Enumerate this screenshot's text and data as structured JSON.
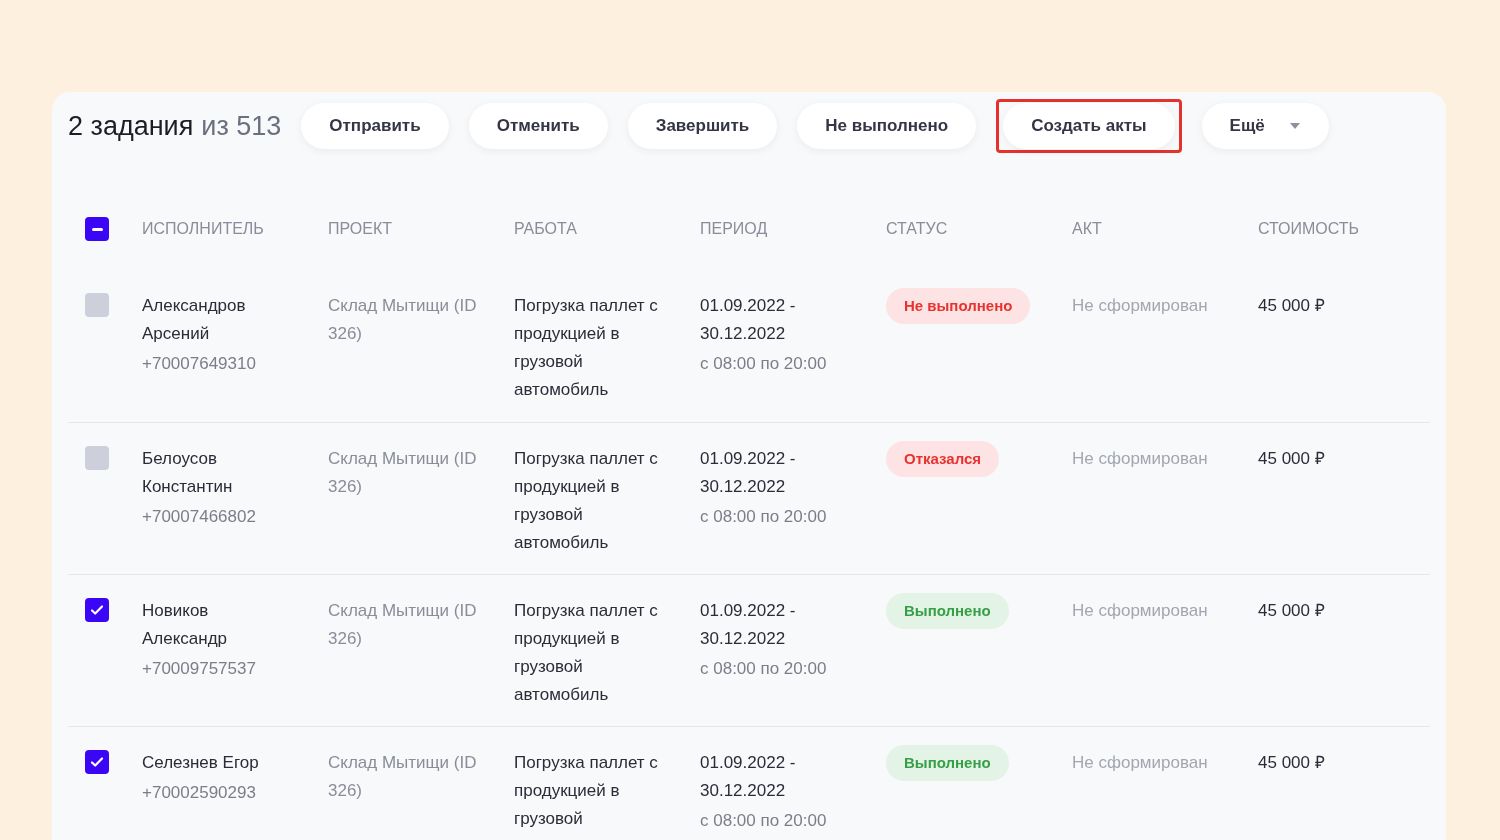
{
  "header": {
    "count": "2 задания",
    "total": "из 513"
  },
  "actions": [
    {
      "label": "Отправить",
      "highlighted": false,
      "kind": "button"
    },
    {
      "label": "Отменить",
      "highlighted": false,
      "kind": "button"
    },
    {
      "label": "Завершить",
      "highlighted": false,
      "kind": "button"
    },
    {
      "label": "Не выполнено",
      "highlighted": false,
      "kind": "button"
    },
    {
      "label": "Создать акты",
      "highlighted": true,
      "kind": "button"
    },
    {
      "label": "Ещё",
      "highlighted": false,
      "kind": "dropdown"
    }
  ],
  "table": {
    "select_all": {
      "partial": true
    },
    "columns": [
      "ИСПОЛНИТЕЛЬ",
      "ПРОЕКТ",
      "РАБОТА",
      "ПЕРИОД",
      "СТАТУС",
      "АКТ",
      "СТОИМОСТЬ"
    ],
    "rows": [
      {
        "checked": false,
        "name": "Александров Арсений",
        "phone": "+70007649310",
        "project": "Склад Мытищи (ID 326)",
        "work": "Погрузка паллет с продукцией в грузовой автомобиль",
        "dates": "01.09.2022 - 30.12.2022",
        "hours": "с 08:00 по 20:00",
        "status": {
          "label": "Не выполнено",
          "kind": "error"
        },
        "act": "Не сформирован",
        "cost": "45 000 ₽"
      },
      {
        "checked": false,
        "name": "Белоусов Константин",
        "phone": "+70007466802",
        "project": "Склад Мытищи (ID 326)",
        "work": "Погрузка паллет с продукцией в грузовой автомобиль",
        "dates": "01.09.2022 - 30.12.2022",
        "hours": "с 08:00 по 20:00",
        "status": {
          "label": "Отказался",
          "kind": "error"
        },
        "act": "Не сформирован",
        "cost": "45 000 ₽"
      },
      {
        "checked": true,
        "name": "Новиков Александр",
        "phone": "+70009757537",
        "project": "Склад Мытищи (ID 326)",
        "work": "Погрузка паллет с продукцией в грузовой автомобиль",
        "dates": "01.09.2022 - 30.12.2022",
        "hours": "с 08:00 по 20:00",
        "status": {
          "label": "Выполнено",
          "kind": "success"
        },
        "act": "Не сформирован",
        "cost": "45 000 ₽"
      },
      {
        "checked": true,
        "name": "Селезнев Егор",
        "phone": "+70002590293",
        "project": "Склад Мытищи (ID 326)",
        "work": "Погрузка паллет с продукцией в грузовой",
        "dates": "01.09.2022 - 30.12.2022",
        "hours": "с 08:00 по 20:00",
        "status": {
          "label": "Выполнено",
          "kind": "success"
        },
        "act": "Не сформирован",
        "cost": "45 000 ₽"
      }
    ]
  }
}
